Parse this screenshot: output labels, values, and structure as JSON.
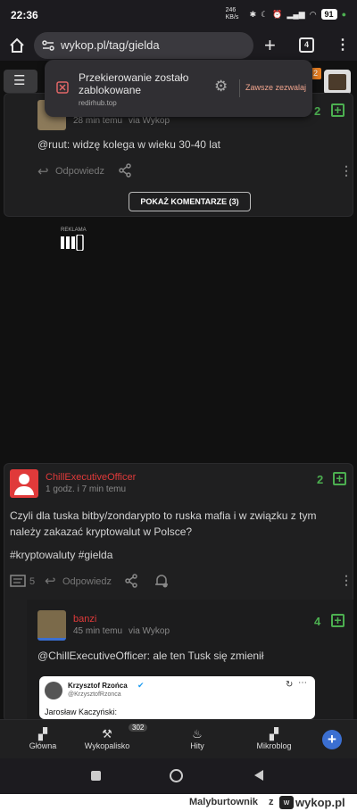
{
  "status": {
    "time": "22:36",
    "net_speed": "246 KB/s",
    "battery": "91"
  },
  "browser": {
    "url": "wykop.pl/tag/gielda",
    "tab_count": "4"
  },
  "popup": {
    "title": "Przekierowanie zostało zablokowane",
    "domain": "redirhub.top",
    "allow_label": "Zawsze zezwalaj"
  },
  "notif_badge": "2",
  "comment1": {
    "time": "28 min temu",
    "via": "via Wykop",
    "votes": "2",
    "text": "@ruut: widzę kolega w wieku 30-40 lat",
    "reply_label": "Odpowiedz"
  },
  "show_comments_label": "POKAŻ KOMENTARZE (3)",
  "ad_label": "REKLAMA",
  "post": {
    "author": "ChillExecutiveOfficer",
    "time": "1 godz. i 7 min temu",
    "votes": "2",
    "text": "Czyli dla tuska bitby/zondarypto to ruska mafia i w związku z tym należy zakazać kryptowalut w Polsce?",
    "tags": "#kryptowaluty #gielda",
    "comment_count": "5",
    "reply_label": "Odpowiedz"
  },
  "comment2": {
    "author": "banzi",
    "time": "45 min temu",
    "via": "via Wykop",
    "votes": "4",
    "text": "@ChillExecutiveOfficer: ale ten Tusk się zmienił",
    "embed_name": "Krzysztof Rzońca",
    "embed_handle": "@KrzysztofRzonca",
    "embed_text": "Jarosław Kaczyński:"
  },
  "nav": {
    "items": [
      {
        "label": "Główna"
      },
      {
        "label": "Wykopalisko",
        "badge": "302"
      },
      {
        "label": "Hity"
      },
      {
        "label": "Mikroblog"
      }
    ]
  },
  "footer": {
    "user": "Malyburtownik",
    "z": "z",
    "site": "wykop.pl"
  },
  "colors": {
    "accent_green": "#4caf50",
    "author_red": "#e03a3a",
    "popup_link": "#f0a58e"
  }
}
